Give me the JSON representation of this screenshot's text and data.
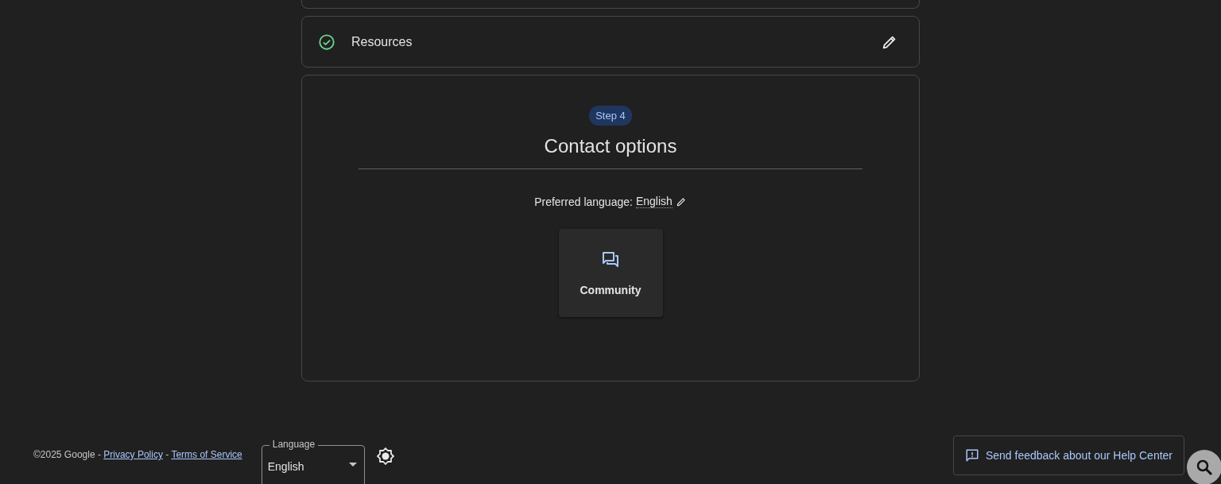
{
  "completed_steps": [
    {
      "title": "Resources",
      "done": true
    }
  ],
  "step": {
    "badge": "Step 4",
    "title": "Contact options",
    "language_label": "Preferred language:",
    "language_value": "English"
  },
  "contact_options": [
    {
      "label": "Community",
      "kind": "community"
    }
  ],
  "footer": {
    "copyright": "©2025 Google",
    "separator": "-",
    "links": [
      "Privacy Policy",
      "Terms of Service"
    ],
    "language_select": {
      "label": "Language",
      "value": "English"
    },
    "feedback_button": "Send feedback about our Help Center"
  }
}
